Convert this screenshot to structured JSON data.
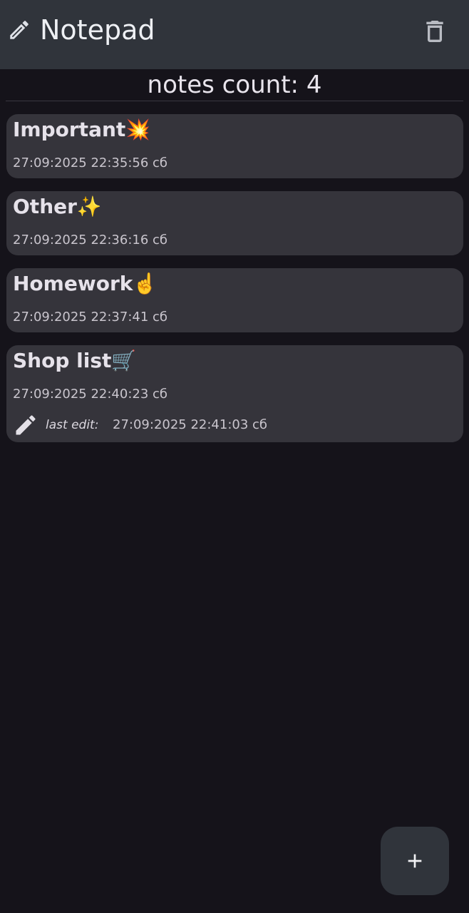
{
  "app": {
    "title": "Notepad",
    "title_icon": "pencil-icon",
    "delete_icon": "trash-icon"
  },
  "notes_count": {
    "text": "notes count: 4"
  },
  "notes": [
    {
      "title": "Important💥",
      "date": "27:09:2025 22:35:56 сб"
    },
    {
      "title": "Other✨",
      "date": "27:09:2025 22:36:16 сб"
    },
    {
      "title": "Homework☝️",
      "date": "27:09:2025 22:37:41 сб"
    },
    {
      "title": "Shop list🛒",
      "date": "27:09:2025 22:40:23 сб",
      "last_edit_label": "last edit:",
      "last_edit_date": "27:09:2025 22:41:03 сб"
    }
  ],
  "fab": {
    "icon": "plus-icon"
  },
  "colors": {
    "background": "#15131a",
    "topbar": "#30343b",
    "card": "#35343b",
    "text": "#e6e2ea"
  }
}
